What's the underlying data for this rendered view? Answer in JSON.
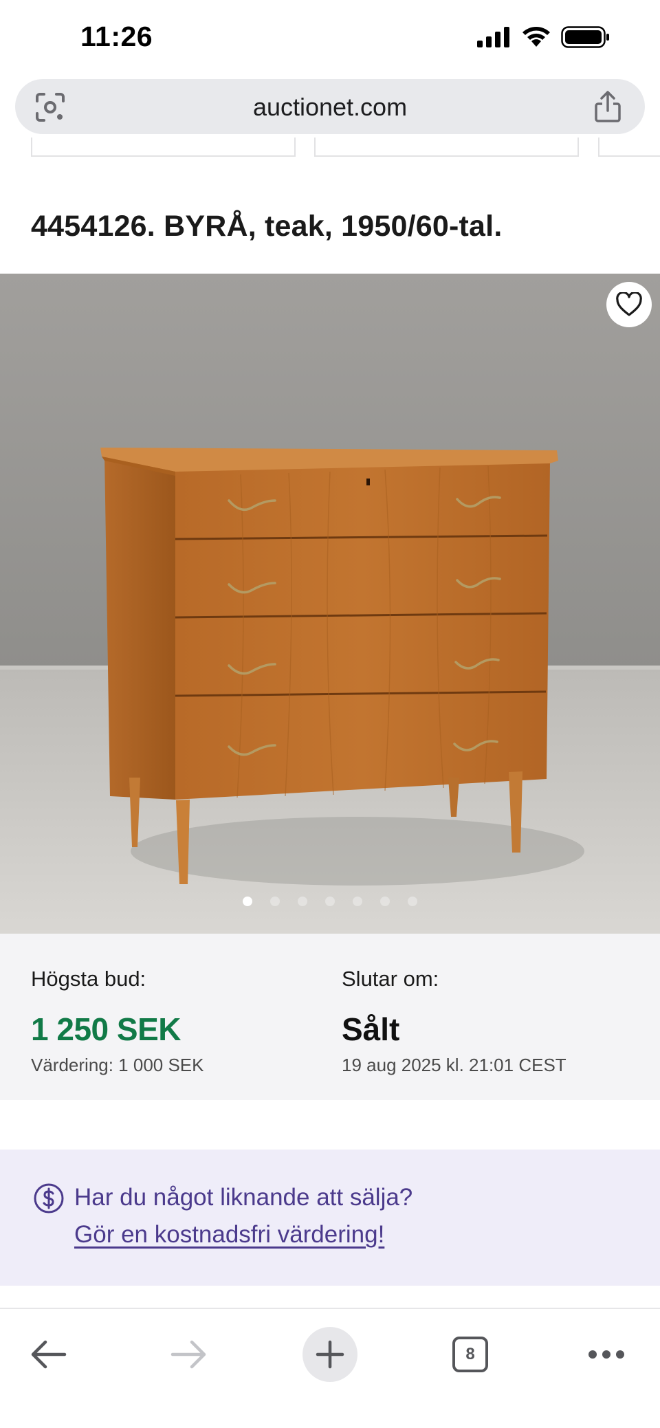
{
  "status_bar": {
    "time": "11:26",
    "icons": [
      "cellular-signal-icon",
      "wifi-icon",
      "battery-icon"
    ]
  },
  "browser": {
    "url": "auctionet.com",
    "left_icon": "visual-lookup-icon",
    "right_icon": "share-icon"
  },
  "item": {
    "title": "4454126. BYRÅ, teak, 1950/60-tal.",
    "image_dot_count": 7,
    "active_image_index": 0
  },
  "bid": {
    "highest_label": "Högsta bud:",
    "highest_amount": "1 250 SEK",
    "estimate": "Värdering: 1 000 SEK",
    "ends_label": "Slutar om:",
    "status": "Sålt",
    "end_date": "19 aug 2025 kl. 21:01 CEST"
  },
  "promo": {
    "question": "Har du något liknande att sälja?",
    "link": "Gör en kostnadsfri värdering!"
  },
  "toolbar": {
    "tab_count": "8"
  },
  "colors": {
    "price_green": "#117a47",
    "promo_purple": "#4b3a8c",
    "promo_bg": "#efedf9"
  }
}
